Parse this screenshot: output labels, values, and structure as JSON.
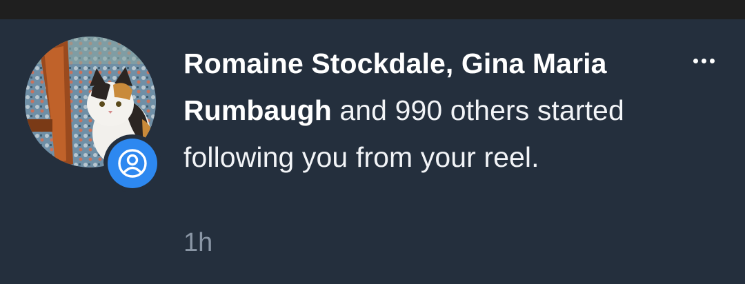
{
  "notification": {
    "actors_bold": "Romaine Stockdale, Gina Maria Rumbaugh",
    "message_rest": " and 990 others started following you from your reel.",
    "timestamp": "1h",
    "badge_icon": "user-circle-icon",
    "more_icon": "more-horizontal-icon"
  },
  "colors": {
    "background": "#242f3d",
    "badge": "#2d88f0",
    "timestamp": "#8a96a5"
  }
}
